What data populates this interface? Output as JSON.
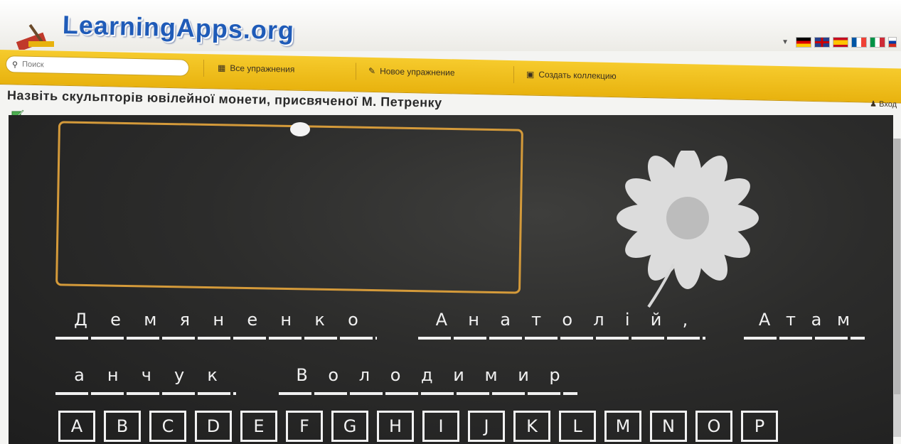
{
  "header": {
    "logo_text": "LearningApps.org",
    "language_flags": [
      "de-flag-icon",
      "uk-flag-icon",
      "es-flag-icon",
      "fr-flag-icon",
      "it-flag-icon",
      "ru-flag-icon"
    ]
  },
  "nav": {
    "search_placeholder": "Поиск",
    "all_exercises": "Все упражнения",
    "new_exercise": "Новое упражнение",
    "create_collection": "Создать коллекцию",
    "login": "Вход"
  },
  "exercise": {
    "title": "Назвіть скульпторів ювілейної монети, присвяченої М. Петренку",
    "words": [
      {
        "letters": [
          "Д",
          "е",
          "м",
          "я",
          "н",
          "е",
          "н",
          "к",
          "о"
        ]
      },
      {
        "letters": [
          "А",
          "н",
          "а",
          "т",
          "о",
          "л",
          "і",
          "й",
          ","
        ]
      },
      {
        "letters": [
          "А",
          "т",
          "а",
          "м"
        ]
      },
      {
        "letters": [
          "а",
          "н",
          "ч",
          "у",
          "к"
        ]
      },
      {
        "letters": [
          "В",
          "о",
          "л",
          "о",
          "д",
          "и",
          "м",
          "и",
          "р"
        ]
      }
    ],
    "keys": [
      "A",
      "B",
      "C",
      "D",
      "E",
      "F",
      "G",
      "H",
      "I",
      "J",
      "K",
      "L",
      "M",
      "N",
      "O",
      "P"
    ]
  },
  "colors": {
    "nav_bg": "#f0bd1f",
    "board_bg": "#2c2c2b",
    "answer_border": "#d49a3a",
    "logo_blue": "#1f5bb8"
  }
}
